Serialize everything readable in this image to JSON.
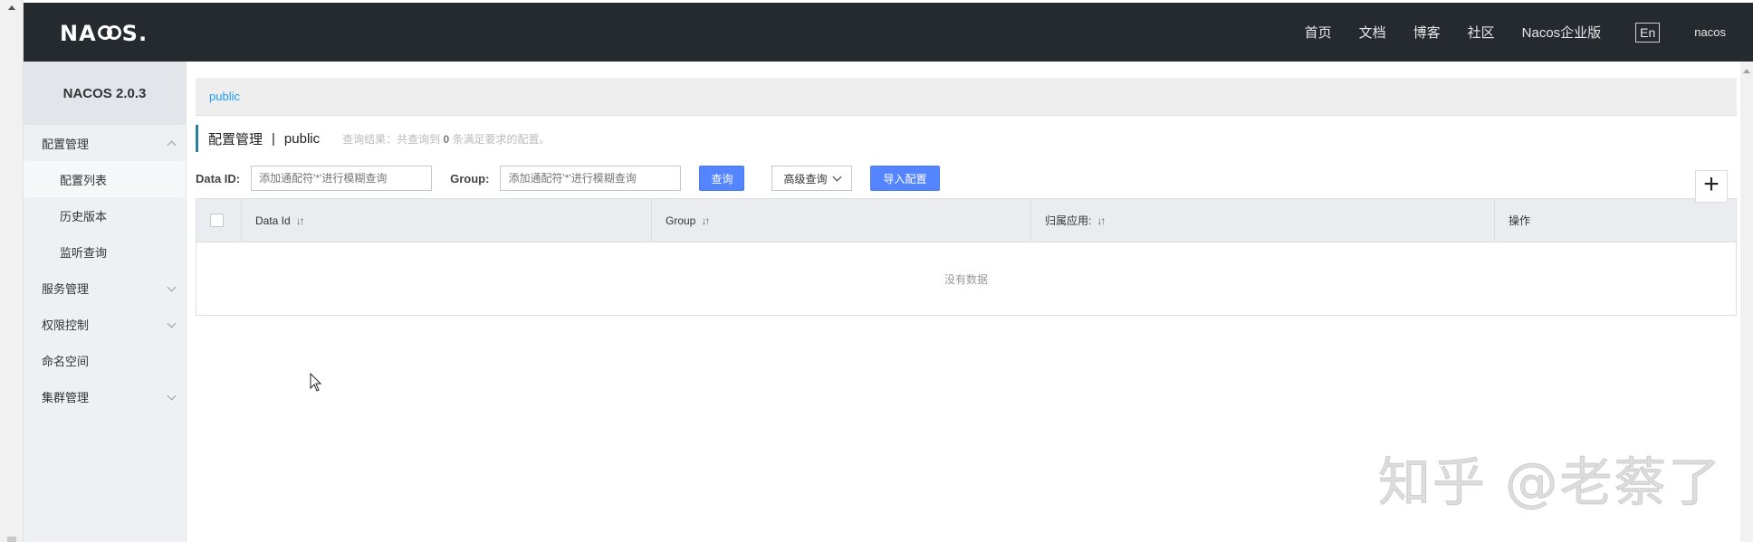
{
  "header": {
    "logo_text": "NACOS.",
    "nav": [
      "首页",
      "文档",
      "博客",
      "社区",
      "Nacos企业版"
    ],
    "lang_toggle": "En",
    "user": "nacos"
  },
  "sidebar": {
    "title": "NACOS 2.0.3",
    "groups": [
      {
        "label": "配置管理",
        "expanded": true,
        "children": [
          "配置列表",
          "历史版本",
          "监听查询"
        ]
      },
      {
        "label": "服务管理",
        "expanded": false
      },
      {
        "label": "权限控制",
        "expanded": false
      },
      {
        "label": "命名空间"
      },
      {
        "label": "集群管理",
        "expanded": false
      }
    ],
    "active_child": "配置列表"
  },
  "main": {
    "breadcrumb": "public",
    "page_title": "配置管理",
    "separator": "|",
    "namespace": "public",
    "result_prefix": "查询结果：共查询到",
    "result_count": "0",
    "result_suffix": "条满足要求的配置。",
    "filters": {
      "data_id_label": "Data ID:",
      "data_id_placeholder": "添加通配符'*'进行模糊查询",
      "group_label": "Group:",
      "group_placeholder": "添加通配符'*'进行模糊查询",
      "search_button": "查询",
      "advanced_button": "高级查询",
      "import_button": "导入配置",
      "add_button": "+"
    },
    "table": {
      "columns": [
        "Data Id",
        "Group",
        "归属应用:",
        "操作"
      ],
      "empty_text": "没有数据"
    }
  },
  "watermark": "知乎 @老蔡了",
  "colors": {
    "topbar": "#252a2f",
    "primary_button": "#5584ff",
    "breadcrumb_link": "#209bfa"
  }
}
